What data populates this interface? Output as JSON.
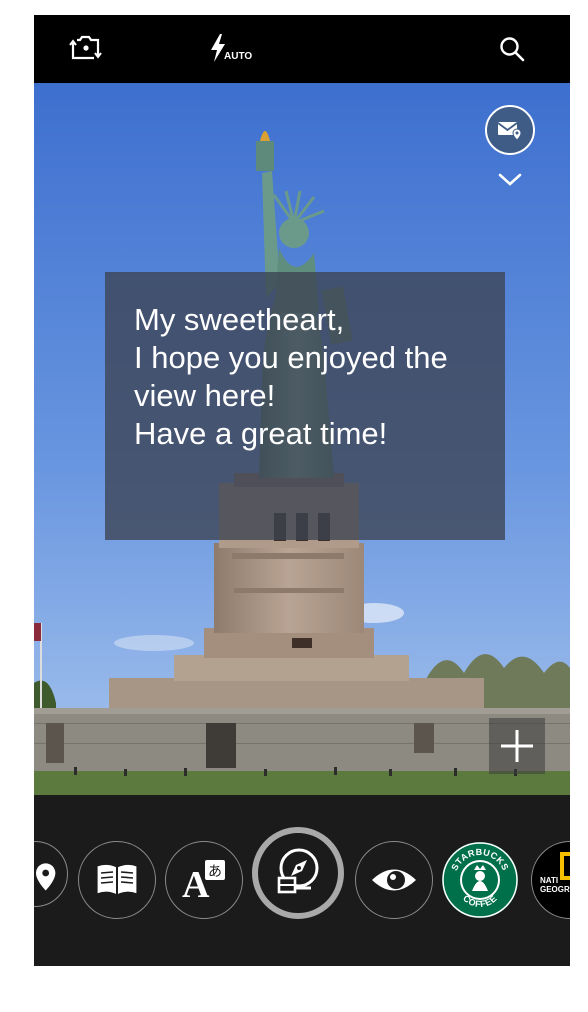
{
  "top_bar": {
    "switch_camera_icon": "switch-camera-icon",
    "flash_label": "AUTO",
    "search_icon": "search-icon"
  },
  "viewfinder": {
    "message_lines": [
      "My sweetheart,",
      "I hope you enjoyed the",
      "view here!",
      "Have a great time!"
    ],
    "mail_location_icon": "mail-location-icon",
    "collapse_icon": "chevron-down-icon",
    "add_icon": "plus-icon"
  },
  "lens_strip": {
    "items": [
      {
        "name": "location-pin-icon"
      },
      {
        "name": "book-icon"
      },
      {
        "name": "translate-icon"
      },
      {
        "name": "compass-icon",
        "selected": true
      },
      {
        "name": "eye-icon"
      },
      {
        "name": "starbucks-logo",
        "text_top": "STARBUCKS",
        "text_bottom": "COFFEE"
      },
      {
        "name": "national-geographic-logo",
        "text_line1": "NATI",
        "text_line2": "GEOGR"
      }
    ]
  },
  "colors": {
    "top_bar": "#000000",
    "lens_strip": "#1b1b1b",
    "message_box": "#3c4252",
    "mail_button": "#3f5c87",
    "starbucks_green": "#00704a",
    "natgeo_yellow": "#f5c000"
  }
}
